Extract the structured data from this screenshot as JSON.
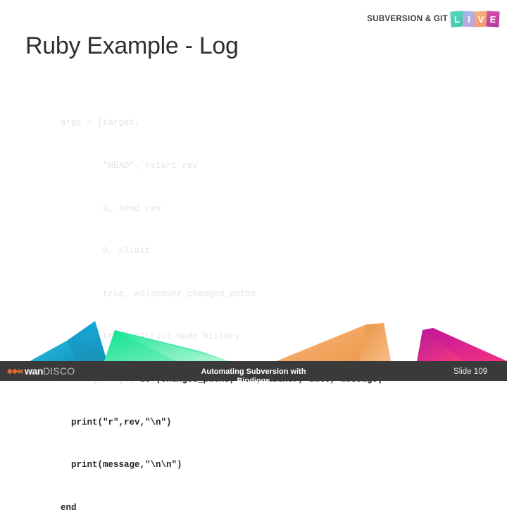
{
  "header": {
    "brand_text": "SUBVERSION & GIT",
    "live_tiles": [
      {
        "letter": "L",
        "color": "#37c9a7"
      },
      {
        "letter": "I",
        "color": "#9fb5e8"
      },
      {
        "letter": "V",
        "color": "#f29a6e"
      },
      {
        "letter": "E",
        "color": "#b23a9a"
      }
    ]
  },
  "slide": {
    "title": "Ruby Example - Log",
    "number_label": "Slide 109",
    "footer_title_line1": "Automating Subversion with",
    "footer_title_line2": "Bindings"
  },
  "code": {
    "language": "ruby",
    "lines": [
      {
        "text": "args = [target,",
        "style": "dim"
      },
      {
        "text": "        \"HEAD\", #start rev",
        "style": "dim"
      },
      {
        "text": "        0, #end rev",
        "style": "dim"
      },
      {
        "text": "        0, #limit",
        "style": "dim"
      },
      {
        "text": "        true, #discover_changed_paths",
        "style": "dim"
      },
      {
        "text": "        true] #strict node history",
        "style": "dim"
      },
      {
        "text": "ctx.log(*args)",
        "style": "dim",
        "suffix": " do |changed_paths, rev, author, date, message|",
        "suffix_style": "solid"
      },
      {
        "text": "  print(\"r\",rev,\"\\n\")",
        "style": "solid"
      },
      {
        "text": "  print(message,\"\\n\\n\")",
        "style": "solid"
      },
      {
        "text": "end",
        "style": "solid"
      }
    ]
  },
  "footer_logo": {
    "name_bold": "wan",
    "name_light": "DISCO",
    "chevron_color": "#e8682a"
  },
  "decor": {
    "shapes": [
      {
        "name": "blue-polygon",
        "color": "#13a9d6"
      },
      {
        "name": "green-polygon",
        "color": "#20e39a"
      },
      {
        "name": "orange-polygon",
        "color": "#f0a35a"
      },
      {
        "name": "magenta-polygon",
        "color": "#e0197f"
      }
    ]
  },
  "colors": {
    "background": "#ffffff",
    "title": "#2f2f2f",
    "footer_bar": "#3a3a3a",
    "code_dim": "#e4e4e4",
    "code_solid": "#262626"
  }
}
